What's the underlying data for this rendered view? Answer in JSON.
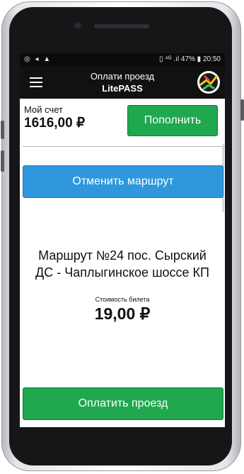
{
  "status_bar": {
    "left_icons": "◎ ◂ ▲",
    "right_text": "▯ ⁴ᴳ .ıl 47% ▮ 20:50"
  },
  "app_bar": {
    "title_line1": "Оплати проезд",
    "title_line2": "LitePASS",
    "menu_icon": "hamburger-menu-icon",
    "logo_icon": "litepass-logo-icon"
  },
  "account": {
    "label": "Мой счет",
    "balance": "1616,00 ₽",
    "topup_label": "Пополнить"
  },
  "cancel_button_label": "Отменить маршрут",
  "route": {
    "line1": "Маршрут №24 пос. Сырский",
    "line2": "ДС - Чаплыгинское шоссе КП"
  },
  "ticket": {
    "label": "Стоимость билета",
    "price": "19,00 ₽"
  },
  "pay_button_label": "Оплатить проезд",
  "colors": {
    "green": "#20a84f",
    "blue": "#2f97dc",
    "appbar": "#111111"
  }
}
